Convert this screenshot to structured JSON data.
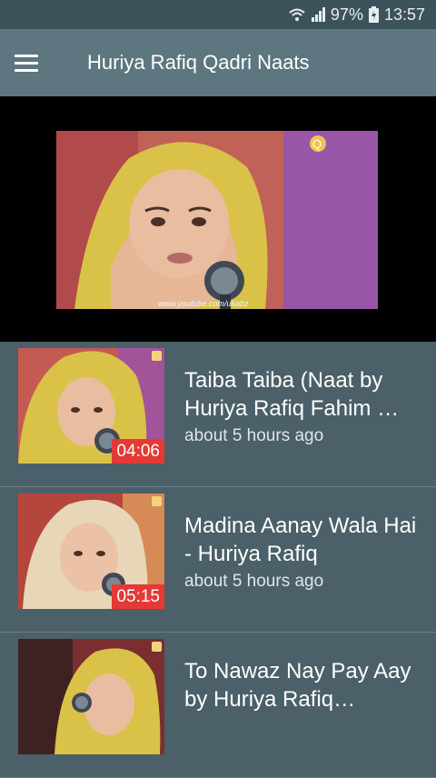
{
  "status_bar": {
    "battery": "97%",
    "time": "13:57"
  },
  "app_bar": {
    "title": "Huriya Rafiq Qadri Naats"
  },
  "player": {
    "watermark": "www.youtube.com/ukabz",
    "channel_logo": "Q"
  },
  "videos": [
    {
      "title": "Taiba Taiba (Naat by Huriya Rafiq Fahim …",
      "duration": "04:06",
      "time": "about 5 hours ago"
    },
    {
      "title": "Madina Aanay Wala Hai - Huriya Rafiq",
      "duration": "05:15",
      "time": "about 5 hours ago"
    },
    {
      "title": "To Nawaz Nay Pay Aay  by Huriya Rafiq…",
      "duration": "",
      "time": ""
    }
  ],
  "colors": {
    "accent": "#e53935",
    "app_bar": "#5d7680",
    "background": "#4b6068"
  }
}
